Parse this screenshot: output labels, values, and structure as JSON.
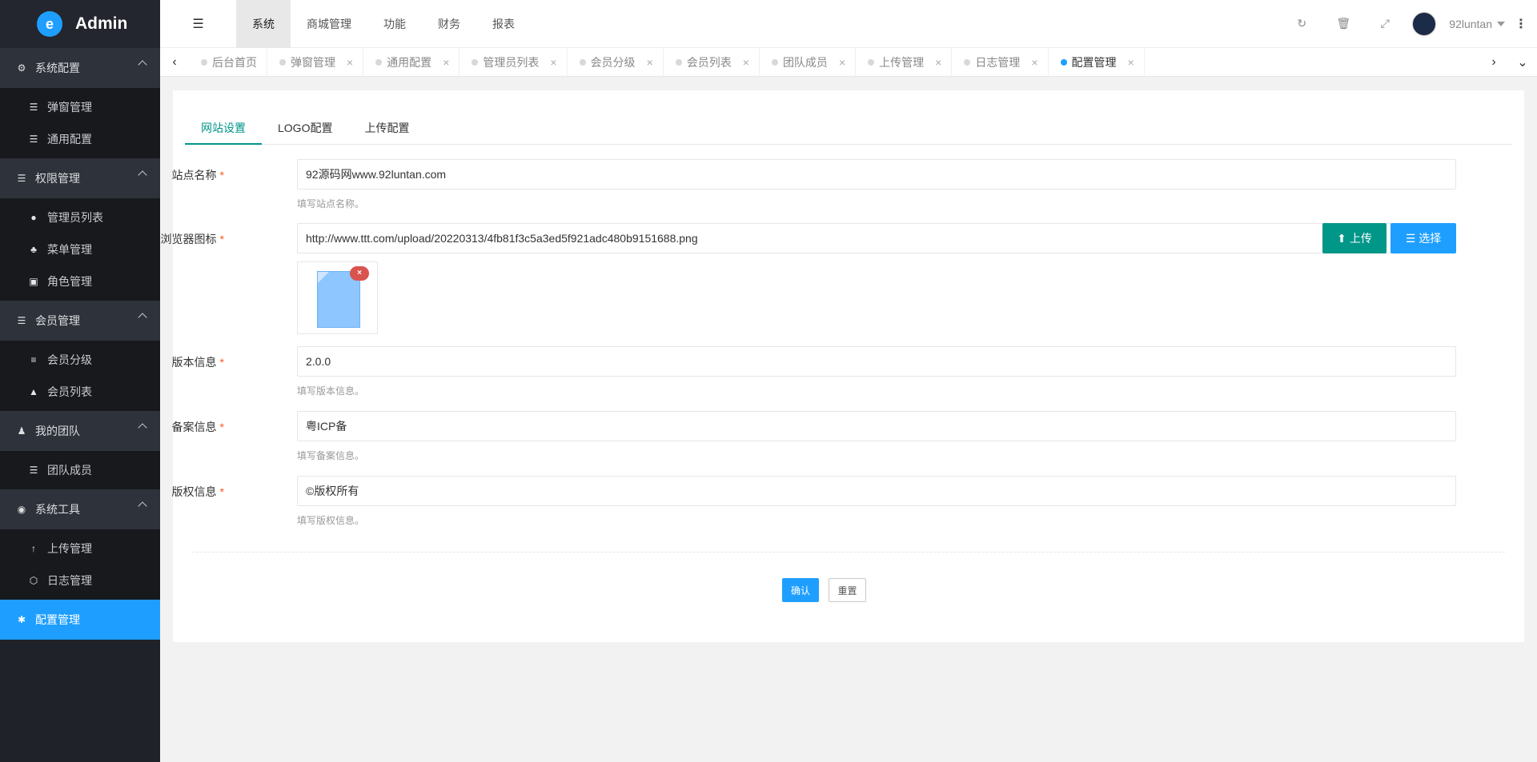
{
  "app": {
    "title": "Admin"
  },
  "sidebar": {
    "groups": [
      {
        "label": "系统配置",
        "icon": "cogs-icon",
        "items": [
          {
            "label": "弹窗管理",
            "icon": "list-icon"
          },
          {
            "label": "通用配置",
            "icon": "list-icon"
          }
        ]
      },
      {
        "label": "权限管理",
        "icon": "list-icon",
        "items": [
          {
            "label": "管理员列表",
            "icon": "user-icon"
          },
          {
            "label": "菜单管理",
            "icon": "tree-icon"
          },
          {
            "label": "角色管理",
            "icon": "id-card-icon"
          }
        ]
      },
      {
        "label": "会员管理",
        "icon": "list-icon",
        "items": [
          {
            "label": "会员分级",
            "icon": "align-icon"
          },
          {
            "label": "会员列表",
            "icon": "graduation-cap-icon"
          }
        ]
      },
      {
        "label": "我的团队",
        "icon": "sitemap-icon",
        "items": [
          {
            "label": "团队成员",
            "icon": "list-icon"
          }
        ]
      },
      {
        "label": "系统工具",
        "icon": "compass-icon",
        "items": [
          {
            "label": "上传管理",
            "icon": "arrow-up-icon"
          },
          {
            "label": "日志管理",
            "icon": "hexagon-icon"
          }
        ]
      }
    ],
    "active_item": {
      "label": "配置管理",
      "icon": "asterisk-icon"
    }
  },
  "topbar": {
    "nav": [
      "系统",
      "商城管理",
      "功能",
      "财务",
      "报表"
    ],
    "active_nav": "系统",
    "username": "92luntan"
  },
  "tabs": [
    "后台首页",
    "弹窗管理",
    "通用配置",
    "管理员列表",
    "会员分级",
    "会员列表",
    "团队成员",
    "上传管理",
    "日志管理",
    "配置管理"
  ],
  "active_tab": "配置管理",
  "form": {
    "tabs": [
      "网站设置",
      "LOGO配置",
      "上传配置"
    ],
    "active_tab": "网站设置",
    "site_name": {
      "label": "站点名称",
      "value": "92源码网www.92luntan.com",
      "tip": "填写站点名称。"
    },
    "favicon": {
      "label": "浏览器图标",
      "value": "http://www.ttt.com/upload/20220313/4fb81f3c5a3ed5f921adc480b9151688.png",
      "upload_label": "上传",
      "select_label": "选择"
    },
    "version": {
      "label": "版本信息",
      "value": "2.0.0",
      "tip": "填写版本信息。"
    },
    "icp": {
      "label": "备案信息",
      "value": "粤ICP备",
      "tip": "填写备案信息。"
    },
    "copyright": {
      "label": "版权信息",
      "value": "©版权所有",
      "tip": "填写版权信息。"
    },
    "confirm_label": "确认",
    "reset_label": "重置"
  }
}
